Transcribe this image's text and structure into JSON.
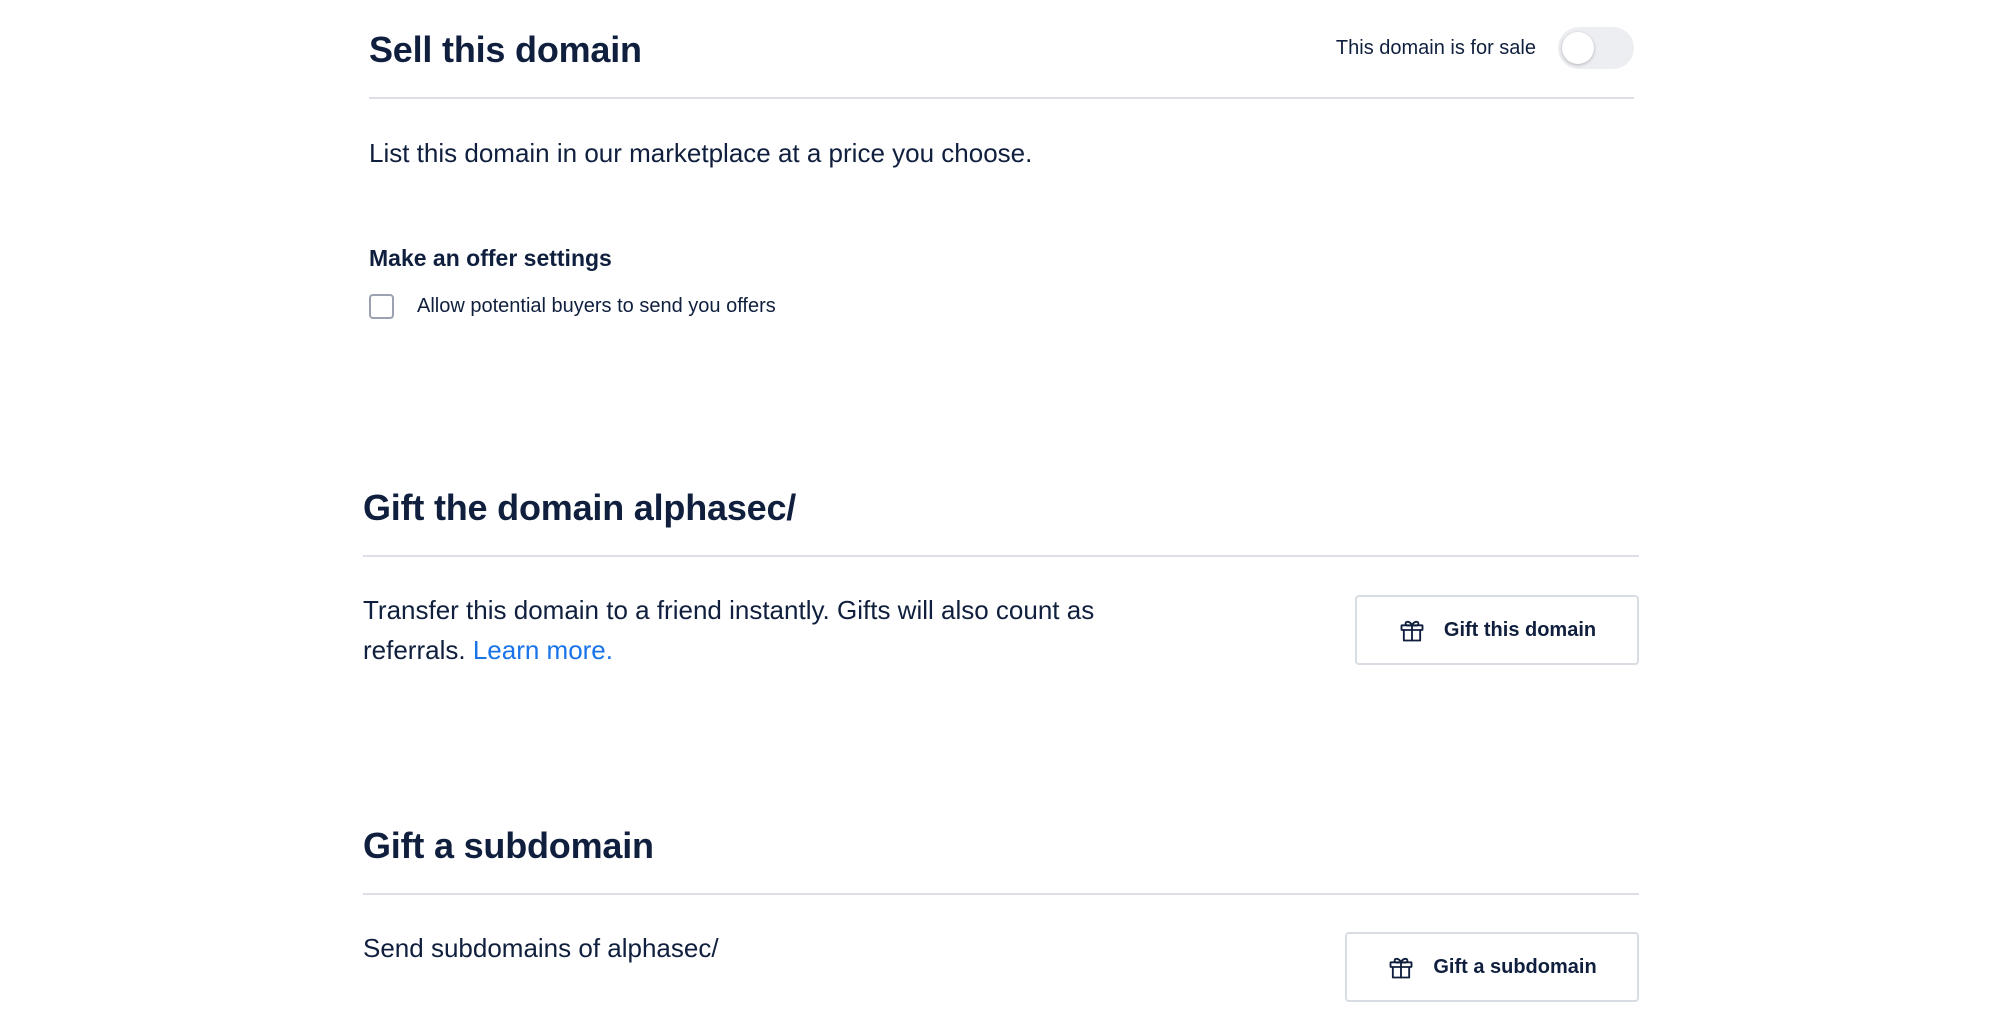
{
  "sell_section": {
    "title": "Sell this domain",
    "sale_toggle_label": "This domain is for sale",
    "sale_toggle_on": false,
    "description": "List this domain in our marketplace at a price you choose.",
    "offer_settings_heading": "Make an offer settings",
    "allow_offers_label": "Allow potential buyers to send you offers",
    "allow_offers_checked": false
  },
  "gift_domain_section": {
    "title": "Gift the domain alphasec/",
    "description": "Transfer this domain to a friend instantly. Gifts will also count as referrals.",
    "learn_more_link": "Learn more.",
    "button_label": "Gift this domain",
    "button_icon": "gift-icon"
  },
  "gift_subdomain_section": {
    "title": "Gift a subdomain",
    "description": "Send subdomains of alphasec/",
    "button_label": "Gift a subdomain",
    "button_icon": "gift-icon"
  },
  "colors": {
    "text": "#0f1f3d",
    "link": "#1a73e8",
    "divider": "#dcdfe5",
    "toggle_off": "#eceef2"
  }
}
